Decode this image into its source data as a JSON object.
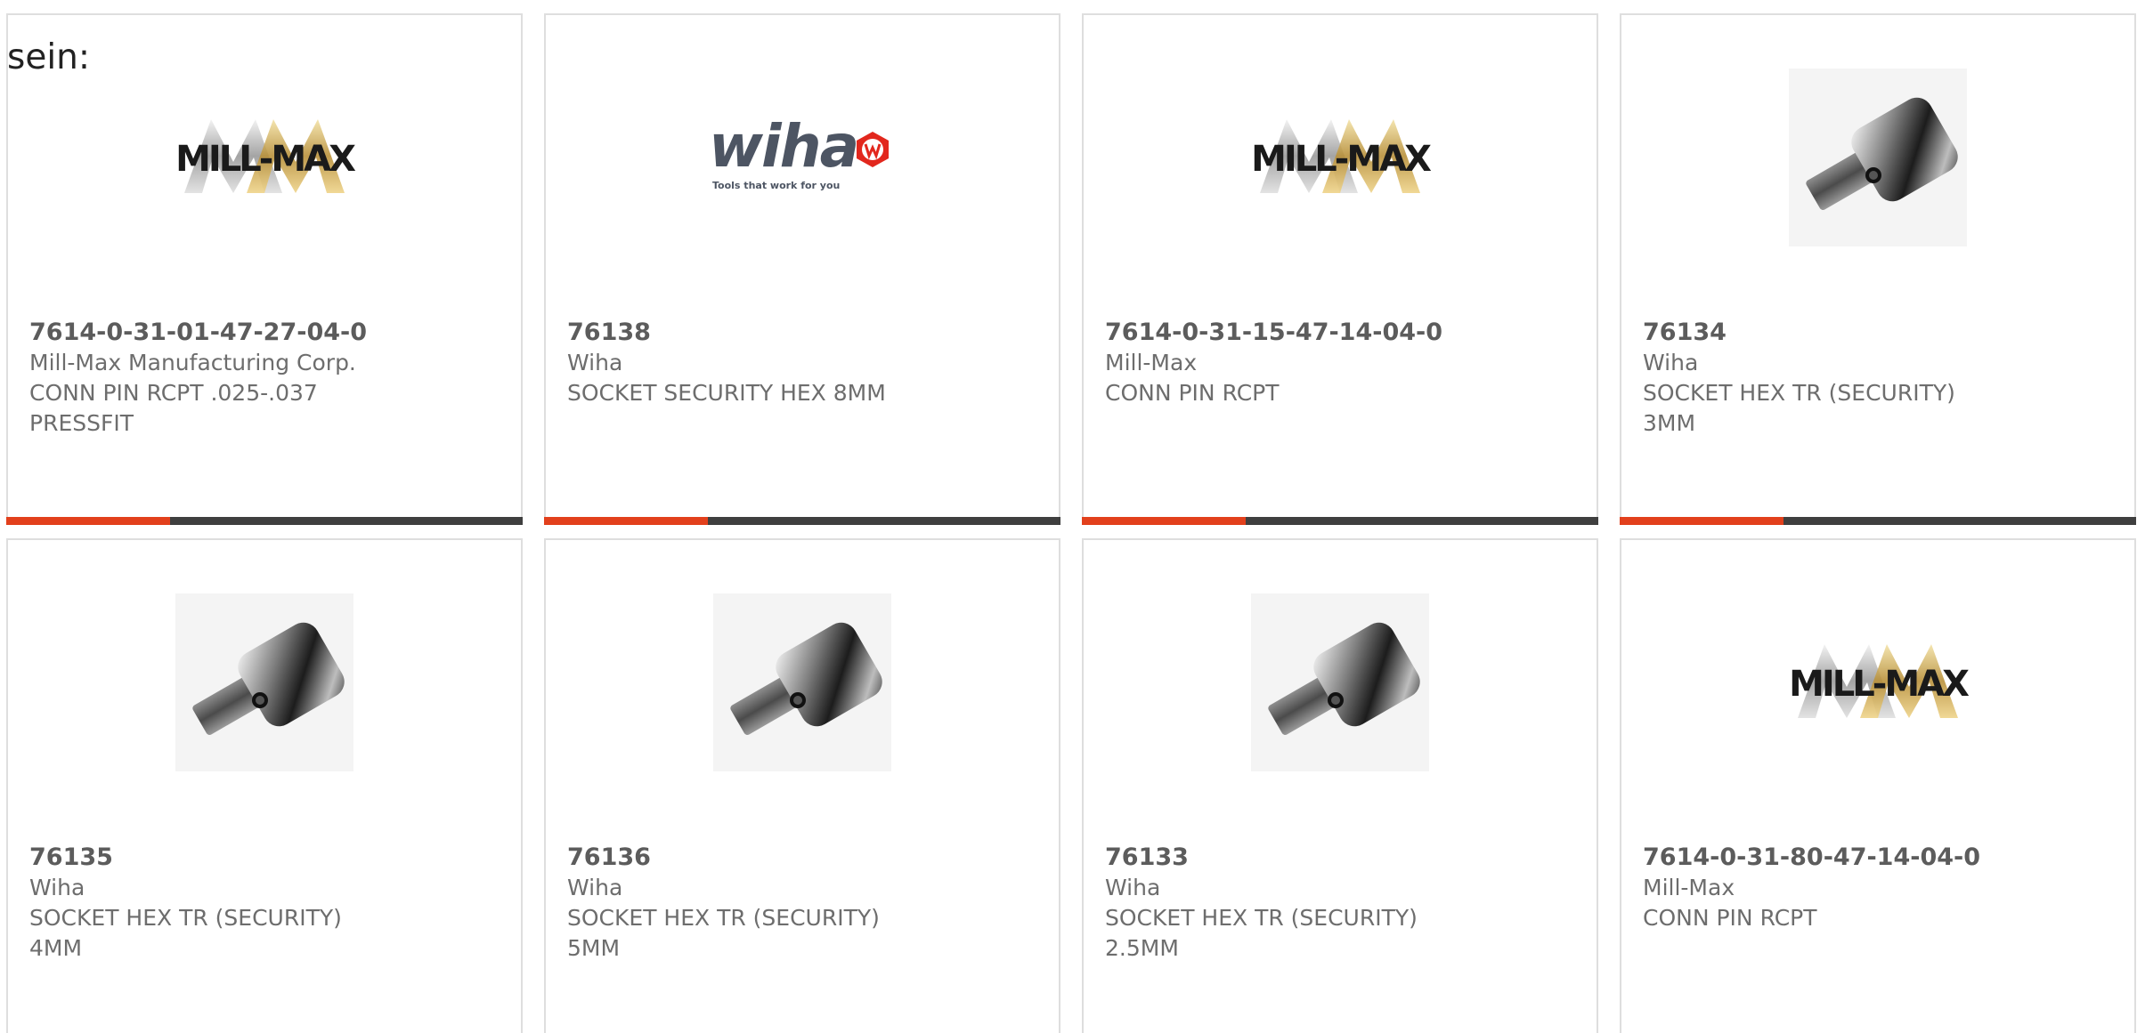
{
  "intro_text": "sein:",
  "brand_colors": {
    "accent_orange": "#e2401c",
    "bar_dark": "#3f3f3f",
    "text_gray": "#6d6d6d"
  },
  "products": [
    {
      "part_number": "7614-0-31-01-47-27-04-0",
      "manufacturer": "Mill-Max Manufacturing Corp.",
      "description_line1": "CONN PIN RCPT .025-.037",
      "description_line2": "PRESSFIT",
      "image": "mill-max-logo",
      "logo_text": "MILL-MAX"
    },
    {
      "part_number": "76138",
      "manufacturer": "Wiha",
      "description_line1": "SOCKET SECURITY HEX 8MM",
      "description_line2": "",
      "image": "wiha-logo",
      "logo_text": "wiha",
      "logo_tagline": "Tools that work for you"
    },
    {
      "part_number": "7614-0-31-15-47-14-04-0",
      "manufacturer": "Mill-Max",
      "description_line1": "CONN PIN RCPT",
      "description_line2": "",
      "image": "mill-max-logo",
      "logo_text": "MILL-MAX"
    },
    {
      "part_number": "76134",
      "manufacturer": "Wiha",
      "description_line1": "SOCKET HEX TR (SECURITY)",
      "description_line2": "3MM",
      "image": "hex-socket-photo"
    },
    {
      "part_number": "76135",
      "manufacturer": "Wiha",
      "description_line1": "SOCKET HEX TR (SECURITY)",
      "description_line2": "4MM",
      "image": "hex-socket-photo"
    },
    {
      "part_number": "76136",
      "manufacturer": "Wiha",
      "description_line1": "SOCKET HEX TR (SECURITY)",
      "description_line2": "5MM",
      "image": "hex-socket-photo"
    },
    {
      "part_number": "76133",
      "manufacturer": "Wiha",
      "description_line1": "SOCKET HEX TR (SECURITY)",
      "description_line2": "2.5MM",
      "image": "hex-socket-photo"
    },
    {
      "part_number": "7614-0-31-80-47-14-04-0",
      "manufacturer": "Mill-Max",
      "description_line1": "CONN PIN RCPT",
      "description_line2": "",
      "image": "mill-max-logo",
      "logo_text": "MILL-MAX"
    }
  ]
}
